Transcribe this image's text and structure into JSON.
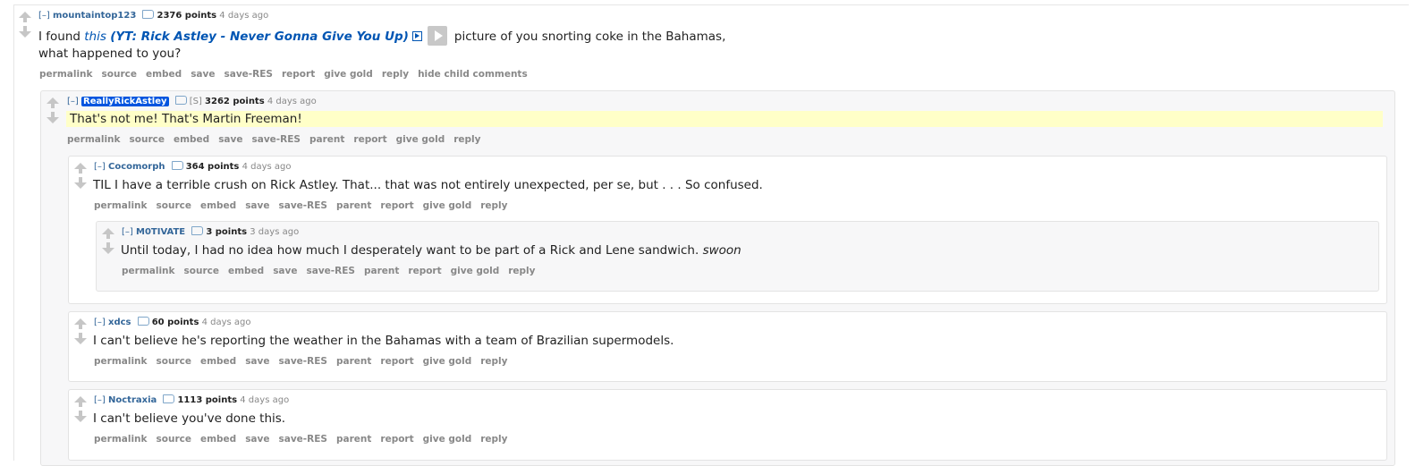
{
  "c1": {
    "toggle": "[–]",
    "author": "mountaintop123",
    "points": "2376 points",
    "time": "4 days ago",
    "body_pre": "I found ",
    "link_this": "this",
    "link_yt": "(YT: Rick Astley - Never Gonna Give You Up)",
    "body_post": "picture of you snorting coke in the Bahamas,",
    "body_line2": "what happened to you?",
    "buttons": [
      "permalink",
      "source",
      "embed",
      "save",
      "save-RES",
      "report",
      "give gold",
      "reply",
      "hide child comments"
    ]
  },
  "c2": {
    "toggle": "[–]",
    "author": "ReallyRickAstley",
    "flair": "[S]",
    "points": "3262 points",
    "time": "4 days ago",
    "body": "That's not me! That's Martin Freeman!",
    "buttons": [
      "permalink",
      "source",
      "embed",
      "save",
      "save-RES",
      "parent",
      "report",
      "give gold",
      "reply"
    ]
  },
  "c3": {
    "toggle": "[–]",
    "author": "Cocomorph",
    "points": "364 points",
    "time": "4 days ago",
    "body": "TIL I have a terrible crush on Rick Astley. That... that was not entirely unexpected, per se, but . . . So confused.",
    "buttons": [
      "permalink",
      "source",
      "embed",
      "save",
      "save-RES",
      "parent",
      "report",
      "give gold",
      "reply"
    ]
  },
  "c4": {
    "toggle": "[–]",
    "author": "M0TIVATE",
    "points": "3 points",
    "time": "3 days ago",
    "body": "Until today, I had no idea how much I desperately want to be part of a Rick and Lene sandwich. ",
    "body_em": "swoon",
    "buttons": [
      "permalink",
      "source",
      "embed",
      "save",
      "save-RES",
      "parent",
      "report",
      "give gold",
      "reply"
    ]
  },
  "c5": {
    "toggle": "[–]",
    "author": "xdcs",
    "points": "60 points",
    "time": "4 days ago",
    "body": "I can't believe he's reporting the weather in the Bahamas with a team of Brazilian supermodels.",
    "buttons": [
      "permalink",
      "source",
      "embed",
      "save",
      "save-RES",
      "parent",
      "report",
      "give gold",
      "reply"
    ]
  },
  "c6": {
    "toggle": "[–]",
    "author": "Noctraxia",
    "points": "1113 points",
    "time": "4 days ago",
    "body": "I can't believe you've done this.",
    "buttons": [
      "permalink",
      "source",
      "embed",
      "save",
      "save-RES",
      "parent",
      "report",
      "give gold",
      "reply"
    ]
  }
}
